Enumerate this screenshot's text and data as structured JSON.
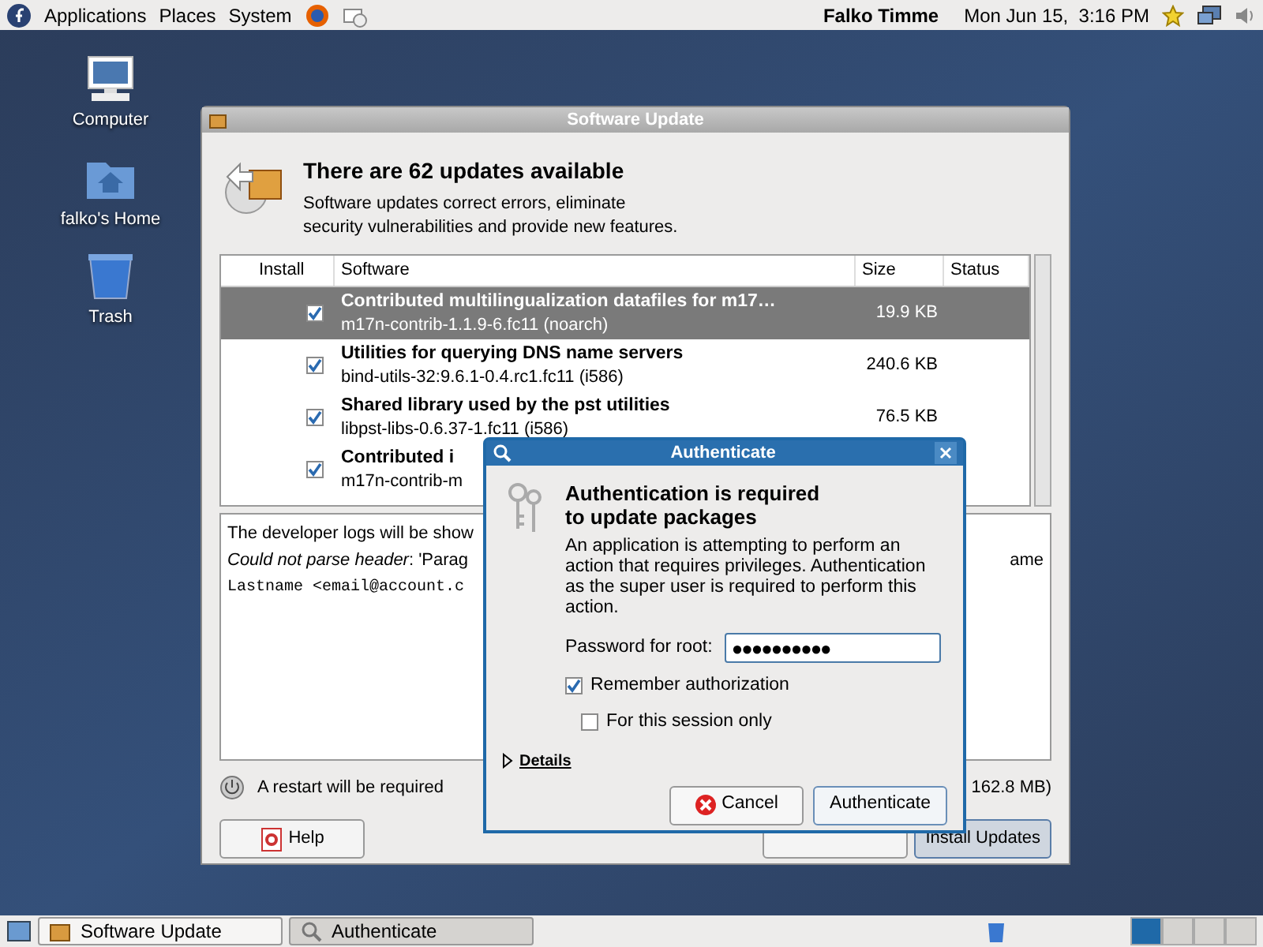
{
  "top_panel": {
    "menus": [
      "Applications",
      "Places",
      "System"
    ],
    "user": "Falko Timme",
    "clock": "Mon Jun 15,  3:16 PM"
  },
  "desktop_icons": [
    {
      "kind": "computer",
      "label": "Computer"
    },
    {
      "kind": "home",
      "label": "falko's Home"
    },
    {
      "kind": "trash",
      "label": "Trash"
    }
  ],
  "update_window": {
    "title": "Software Update",
    "heading": "There are 62 updates available",
    "description": "Software updates correct errors, eliminate\nsecurity vulnerabilities and provide new features.",
    "columns": [
      "Install",
      "Software",
      "Size",
      "Status"
    ],
    "rows": [
      {
        "checked": true,
        "selected": true,
        "summary": "Contributed multilingualization datafiles for m17…",
        "package": "m17n-contrib-1.1.9-6.fc11 (noarch)",
        "size": "19.9 KB"
      },
      {
        "checked": true,
        "selected": false,
        "summary": "Utilities for querying DNS name servers",
        "package": "bind-utils-32:9.6.1-0.4.rc1.fc11 (i586)",
        "size": "240.6 KB"
      },
      {
        "checked": true,
        "selected": false,
        "summary": "Shared library used by the pst utilities",
        "package": "libpst-libs-0.6.37-1.fc11 (i586)",
        "size": "76.5 KB"
      },
      {
        "checked": true,
        "selected": false,
        "summary": "Contributed i",
        "package": "m17n-contrib-m",
        "size": ""
      }
    ],
    "log_lines": [
      "The developer logs will be show",
      "*Could not parse header*: 'Parag",
      "Lastname <email@account.c"
    ],
    "log_right": "ame",
    "restart_note": "A restart will be required",
    "total": "162.8 MB)",
    "help_button": "Help",
    "install_button": "Install Updates"
  },
  "auth_dialog": {
    "title": "Authenticate",
    "heading": "Authentication is required\nto update packages",
    "message": "An application is attempting to perform an action that requires privileges. Authentication as the super user is required to perform this action.",
    "password_label": "Password for root:",
    "password_value": "●●●●●●●●●●",
    "options": [
      {
        "label": "Remember authorization",
        "checked": true
      },
      {
        "label": "For this session only",
        "checked": false
      }
    ],
    "details": "Details",
    "cancel_button": "Cancel",
    "ok_button": "Authenticate"
  },
  "taskbar": [
    {
      "kind": "update",
      "label": "Software Update",
      "selected": false
    },
    {
      "kind": "auth",
      "label": "Authenticate",
      "selected": true
    }
  ]
}
